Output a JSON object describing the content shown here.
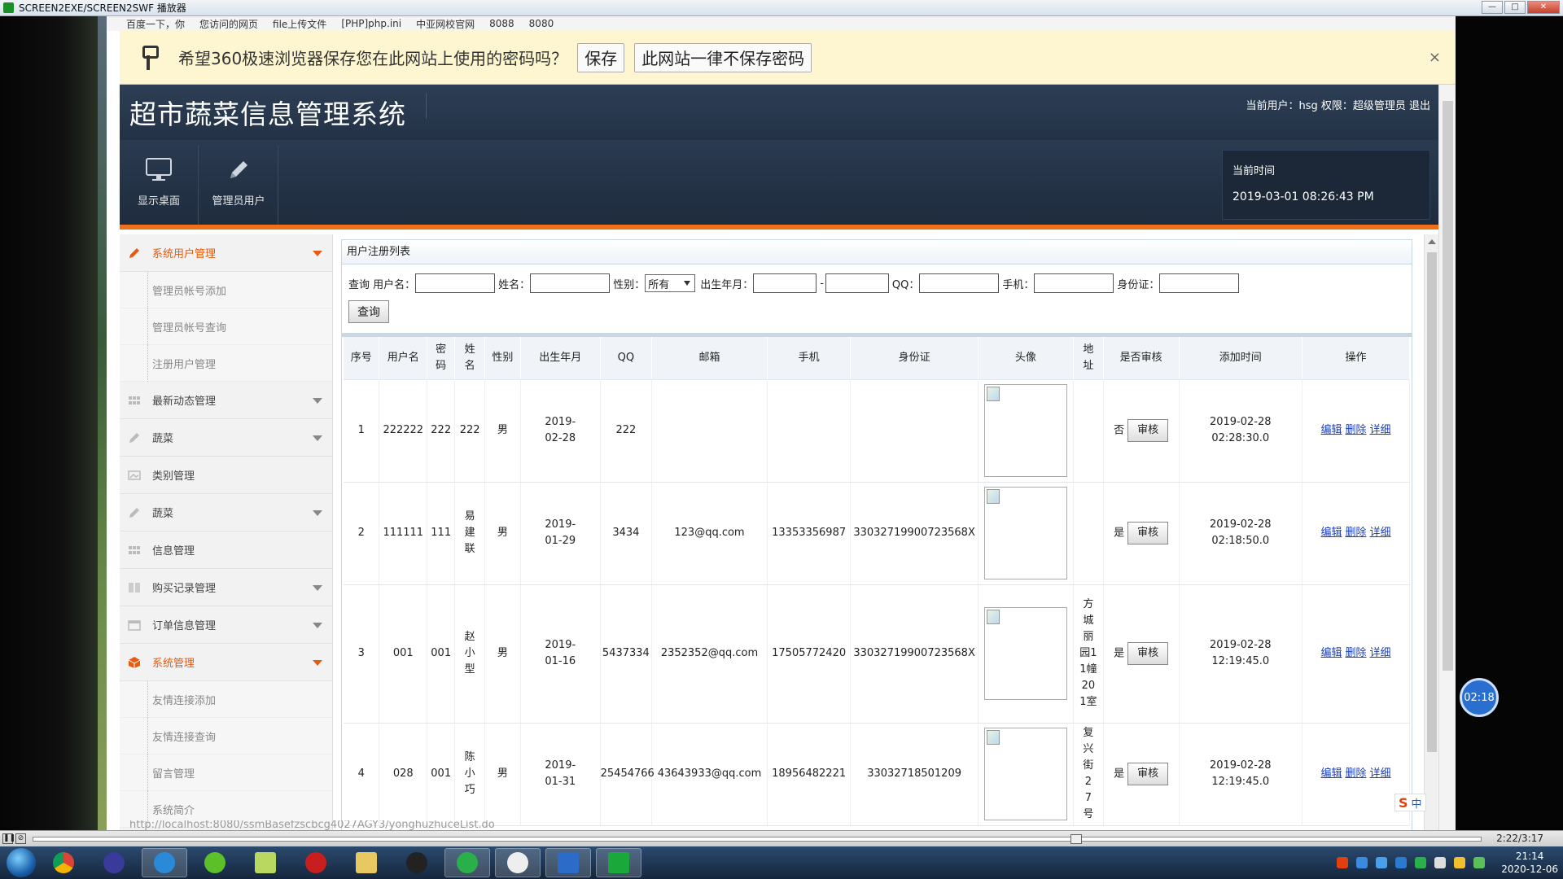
{
  "player": {
    "title": "SCREEN2EXE/SCREEN2SWF 播放器",
    "time": "2:22/3:17",
    "rec_time": "02:18"
  },
  "bookmarks": [
    "百度一下，你",
    "您访问的网页",
    "file上传文件",
    "[PHP]php.ini",
    "中亚网校官网",
    "8088",
    "8080"
  ],
  "pwbar": {
    "message": "希望360极速浏览器保存您在此网站上使用的密码吗？",
    "save": "保存",
    "never": "此网站一律不保存密码",
    "close": "×"
  },
  "header": {
    "title": "超市蔬菜信息管理系统",
    "userinfo": "当前用户：hsg  权限：超级管理员  退出"
  },
  "toolbar": {
    "desktop": "显示桌面",
    "admin": "管理员用户",
    "time_label": "当前时间",
    "time_value": "2019-03-01 08:26:43 PM"
  },
  "sidebar": {
    "items": [
      {
        "label": "系统用户管理",
        "active": true,
        "arrow": true
      },
      {
        "label": "管理员帐号添加",
        "sub": true
      },
      {
        "label": "管理员帐号查询",
        "sub": true
      },
      {
        "label": "注册用户管理",
        "sub": true
      },
      {
        "label": "最新动态管理",
        "arrow": true
      },
      {
        "label": "蔬菜",
        "arrow": true
      },
      {
        "label": "类别管理"
      },
      {
        "label": "蔬菜",
        "arrow": true
      },
      {
        "label": "信息管理"
      },
      {
        "label": "购买记录管理",
        "arrow": true
      },
      {
        "label": "订单信息管理",
        "arrow": true
      },
      {
        "label": "系统管理",
        "active": true,
        "arrow": true
      },
      {
        "label": "友情连接添加",
        "sub": true
      },
      {
        "label": "友情连接查询",
        "sub": true
      },
      {
        "label": "留言管理",
        "sub": true
      },
      {
        "label": "系统简介",
        "sub": true
      }
    ]
  },
  "panel": {
    "title": "用户注册列表"
  },
  "search": {
    "prefix": "查询",
    "username": "用户名：",
    "name": "姓名：",
    "gender": "性别：",
    "gender_value": "所有",
    "birth": "出生年月：",
    "dash": "-",
    "qq": "QQ：",
    "phone": "手机：",
    "idcard": "身份证：",
    "button": "查询"
  },
  "table": {
    "headers": [
      "序号",
      "用户名",
      "密码",
      "姓名",
      "性别",
      "出生年月",
      "QQ",
      "邮箱",
      "手机",
      "身份证",
      "头像",
      "地址",
      "是否审核",
      "添加时间",
      "操作"
    ],
    "audit_label": "审核",
    "ops": [
      "编辑",
      "删除",
      "详细"
    ],
    "rows": [
      {
        "no": "1",
        "username": "222222",
        "password": "222",
        "name": "222",
        "gender": "男",
        "birth": "2019-02-28",
        "qq": "222",
        "email": "",
        "phone": "",
        "idcard": "",
        "address": "",
        "audited": "否",
        "added": "2019-02-28 02:28:30.0"
      },
      {
        "no": "2",
        "username": "111111",
        "password": "111",
        "name": "易建联",
        "gender": "男",
        "birth": "2019-01-29",
        "qq": "3434",
        "email": "123@qq.com",
        "phone": "13353356987",
        "idcard": "33032719900723568X",
        "address": "",
        "audited": "是",
        "added": "2019-02-28 02:18:50.0"
      },
      {
        "no": "3",
        "username": "001",
        "password": "001",
        "name": "赵小型",
        "gender": "男",
        "birth": "2019-01-16",
        "qq": "5437334",
        "email": "2352352@qq.com",
        "phone": "17505772420",
        "idcard": "33032719900723568X",
        "address": "方城丽园11幢201室",
        "audited": "是",
        "added": "2019-02-28 12:19:45.0"
      },
      {
        "no": "4",
        "username": "028",
        "password": "001",
        "name": "陈小巧",
        "gender": "男",
        "birth": "2019-01-31",
        "qq": "25454766",
        "email": "43643933@qq.com",
        "phone": "18956482221",
        "idcard": "33032718501209",
        "address": "复兴街27号",
        "audited": "是",
        "added": "2019-02-28 12:19:45.0"
      }
    ]
  },
  "status_url": "http://localhost:8080/ssmBasefzscbcg4027AGY3/yonghuzhuceList.do",
  "taskbar": {
    "clock_time": "21:14",
    "clock_date": "2020-12-06"
  },
  "ime": {
    "logo": "S",
    "label": "中"
  },
  "colors": {
    "header_bg": "#2d3e55",
    "accent_orange": "#f07018",
    "link_blue": "#1a3fbf",
    "pwbar_bg": "#fdf6d0"
  }
}
